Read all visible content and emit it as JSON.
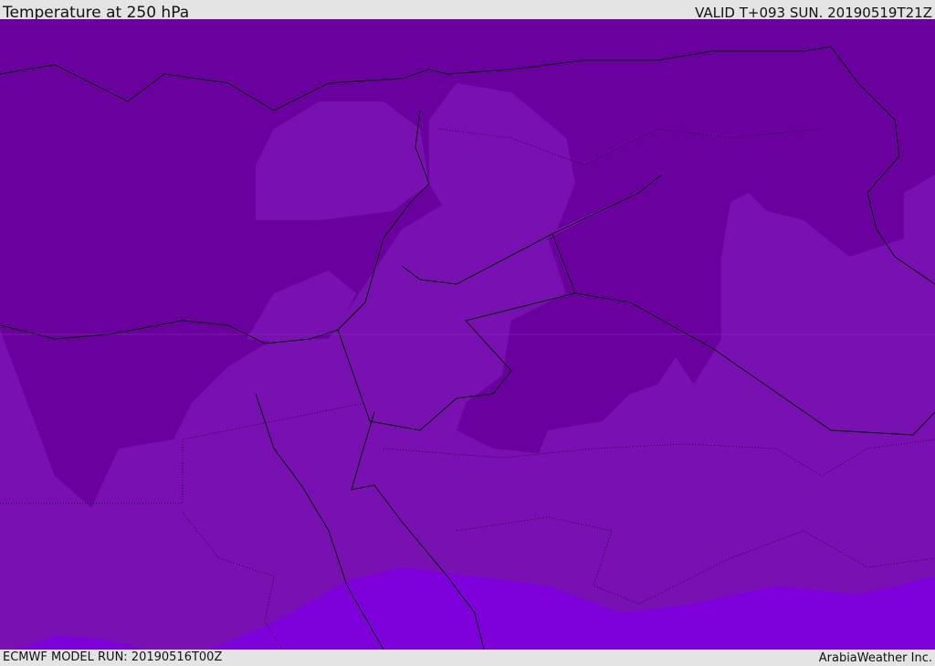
{
  "header": {
    "title": "Temperature at 250 hPa",
    "valid": "VALID T+093 SUN. 20190519T21Z"
  },
  "footer": {
    "model_run": "ECMWF MODEL RUN: 20190516T00Z",
    "brand": "ArabiaWeather Inc."
  },
  "colors": {
    "cold": "#6a009e",
    "mid": "#7810b2",
    "warm": "#7e00da",
    "border": "#000000"
  }
}
